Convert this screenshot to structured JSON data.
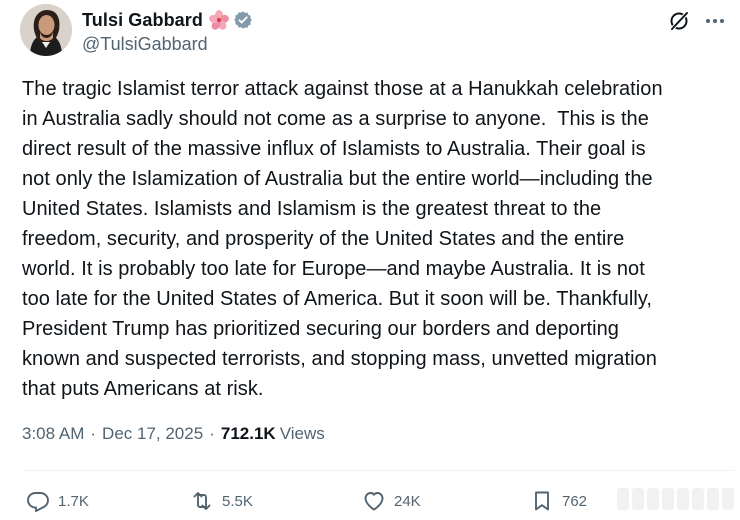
{
  "author": {
    "display_name": "Tulsi Gabbard",
    "handle": "@TulsiGabbard",
    "name_emoji": "hibiscus-emoji",
    "verified_badge": "verified-badge-icon",
    "colors": {
      "verified": "#829aab",
      "hibiscus": "#f4a7b9"
    }
  },
  "header": {
    "grok_icon": "grok-icon",
    "more_icon": "more-options-icon"
  },
  "tweet": {
    "text": "The tragic Islamist terror attack against those at a Hanukkah celebration\nin Australia sadly should not come as a surprise to anyone.  This is the\ndirect result of the massive influx of Islamists to Australia. Their goal is\nnot only the Islamization of Australia but the entire world—including the\nUnited States. Islamists and Islamism is the greatest threat to the\nfreedom, security, and prosperity of the United States and the entire\nworld. It is probably too late for Europe—and maybe Australia. It is not\ntoo late for the United States of America. But it soon will be. Thankfully,\nPresident Trump has prioritized securing our borders and deporting\nknown and suspected terrorists, and stopping mass, unvetted migration\nthat puts Americans at risk."
  },
  "meta": {
    "time": "3:08 AM",
    "separator": "·",
    "date": "Dec 17, 2025",
    "views_count": "712.1K",
    "views_label": "Views"
  },
  "actions": {
    "replies": "1.7K",
    "reposts": "5.5K",
    "likes": "24K",
    "bookmarks": "762"
  },
  "colors": {
    "text": "#0f1419",
    "secondary": "#536471",
    "divider": "#eff3f4"
  }
}
